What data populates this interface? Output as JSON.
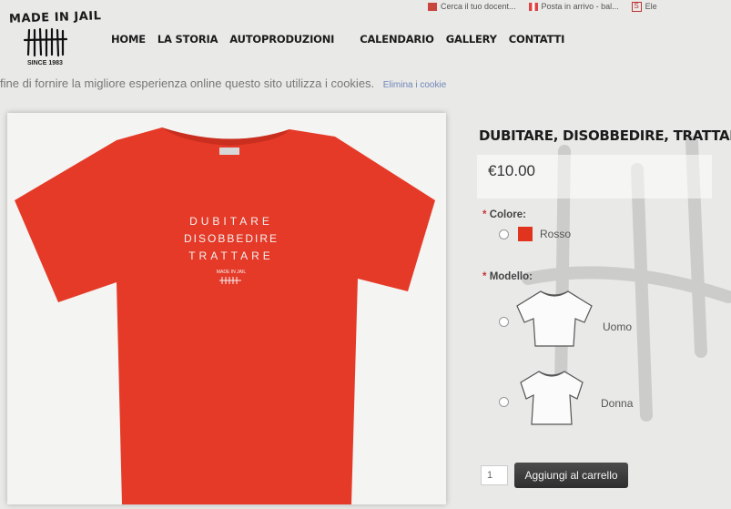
{
  "browser_bookmarks": [
    {
      "icon": "red-bookmark-icon",
      "label": "Cerca il tuo docent..."
    },
    {
      "icon": "gmail-icon",
      "label": "Posta in arrivo - bal..."
    },
    {
      "icon": "s-icon",
      "label": "Ele"
    }
  ],
  "brand": {
    "logo_text": "MADE IN JAIL",
    "since": "SINCE 1983"
  },
  "nav": [
    "HOME",
    "LA STORIA",
    "AUTOPRODUZIONI",
    "CALENDARIO",
    "GALLERY",
    "CONTATTI"
  ],
  "cookie_notice": {
    "text": "fine di fornire la migliore esperienza online questo sito utilizza i cookies.",
    "link": "Elimina i cookie"
  },
  "product": {
    "title": "DUBITARE, DISOBBEDIRE, TRATTARE",
    "price": "€10.00",
    "image_print": [
      "DUBITARE",
      "DISOBBEDIRE",
      "TRATTARE"
    ],
    "image_print_small": "MADE IN JAIL",
    "shirt_color": "#e53a28",
    "color_label": "Colore:",
    "required_mark": "*",
    "colors": [
      {
        "label": "Rosso",
        "hex": "#e0341f"
      }
    ],
    "model_label": "Modello:",
    "models": [
      {
        "label": "Uomo"
      },
      {
        "label": "Donna"
      }
    ],
    "quantity": "1",
    "add_to_cart": "Aggiungi al carrello"
  }
}
